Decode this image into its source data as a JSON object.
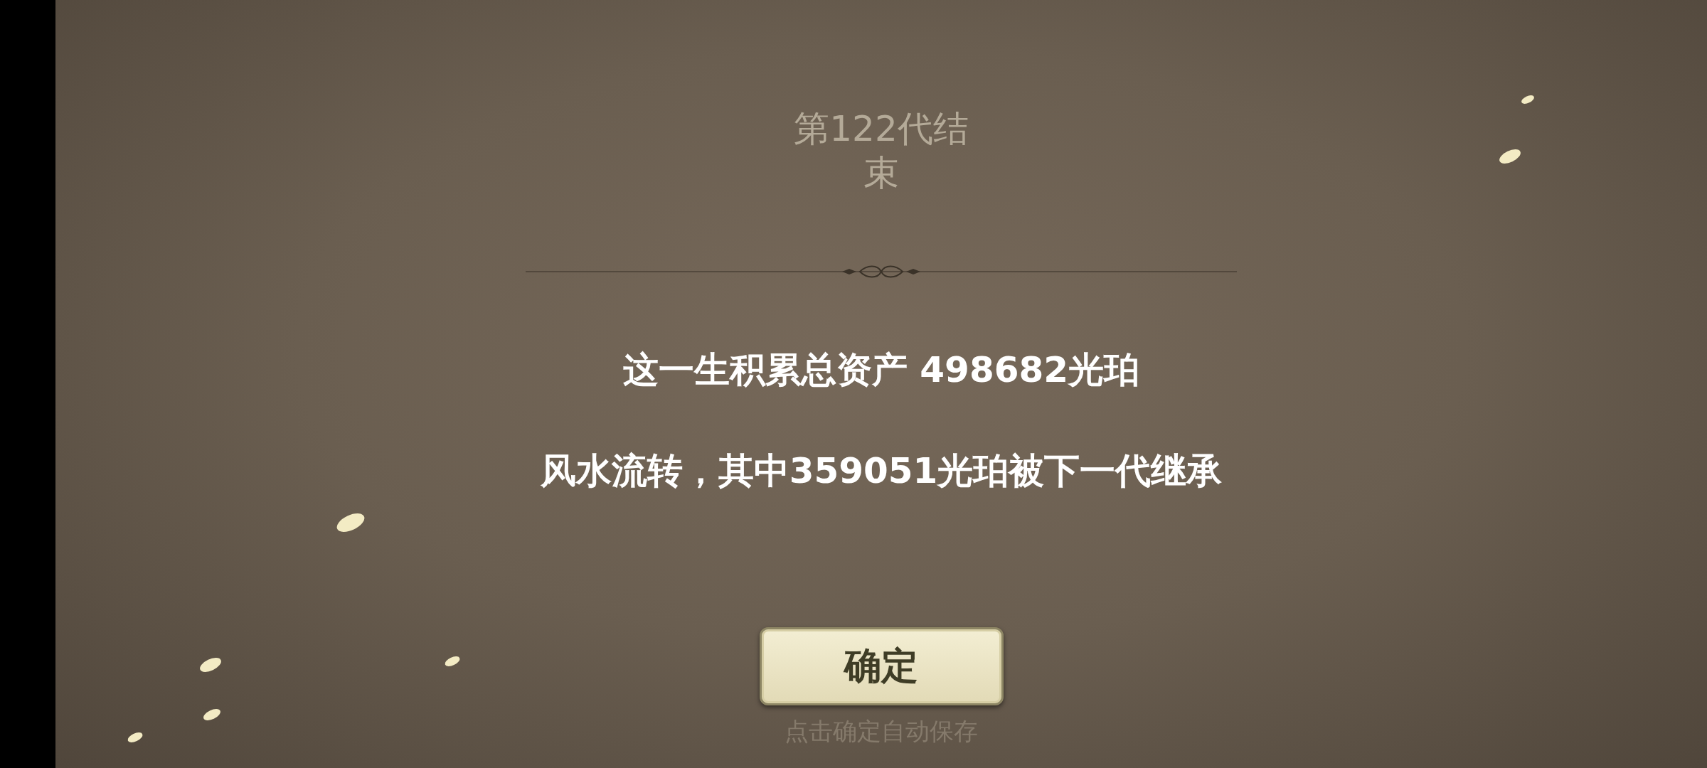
{
  "title": "第122代结束",
  "summary_lines": [
    "这一生积累总资产 498682光珀",
    "风水流转，其中359051光珀被下一代继承"
  ],
  "confirm_button": "确定",
  "hint": "点击确定自动保存"
}
